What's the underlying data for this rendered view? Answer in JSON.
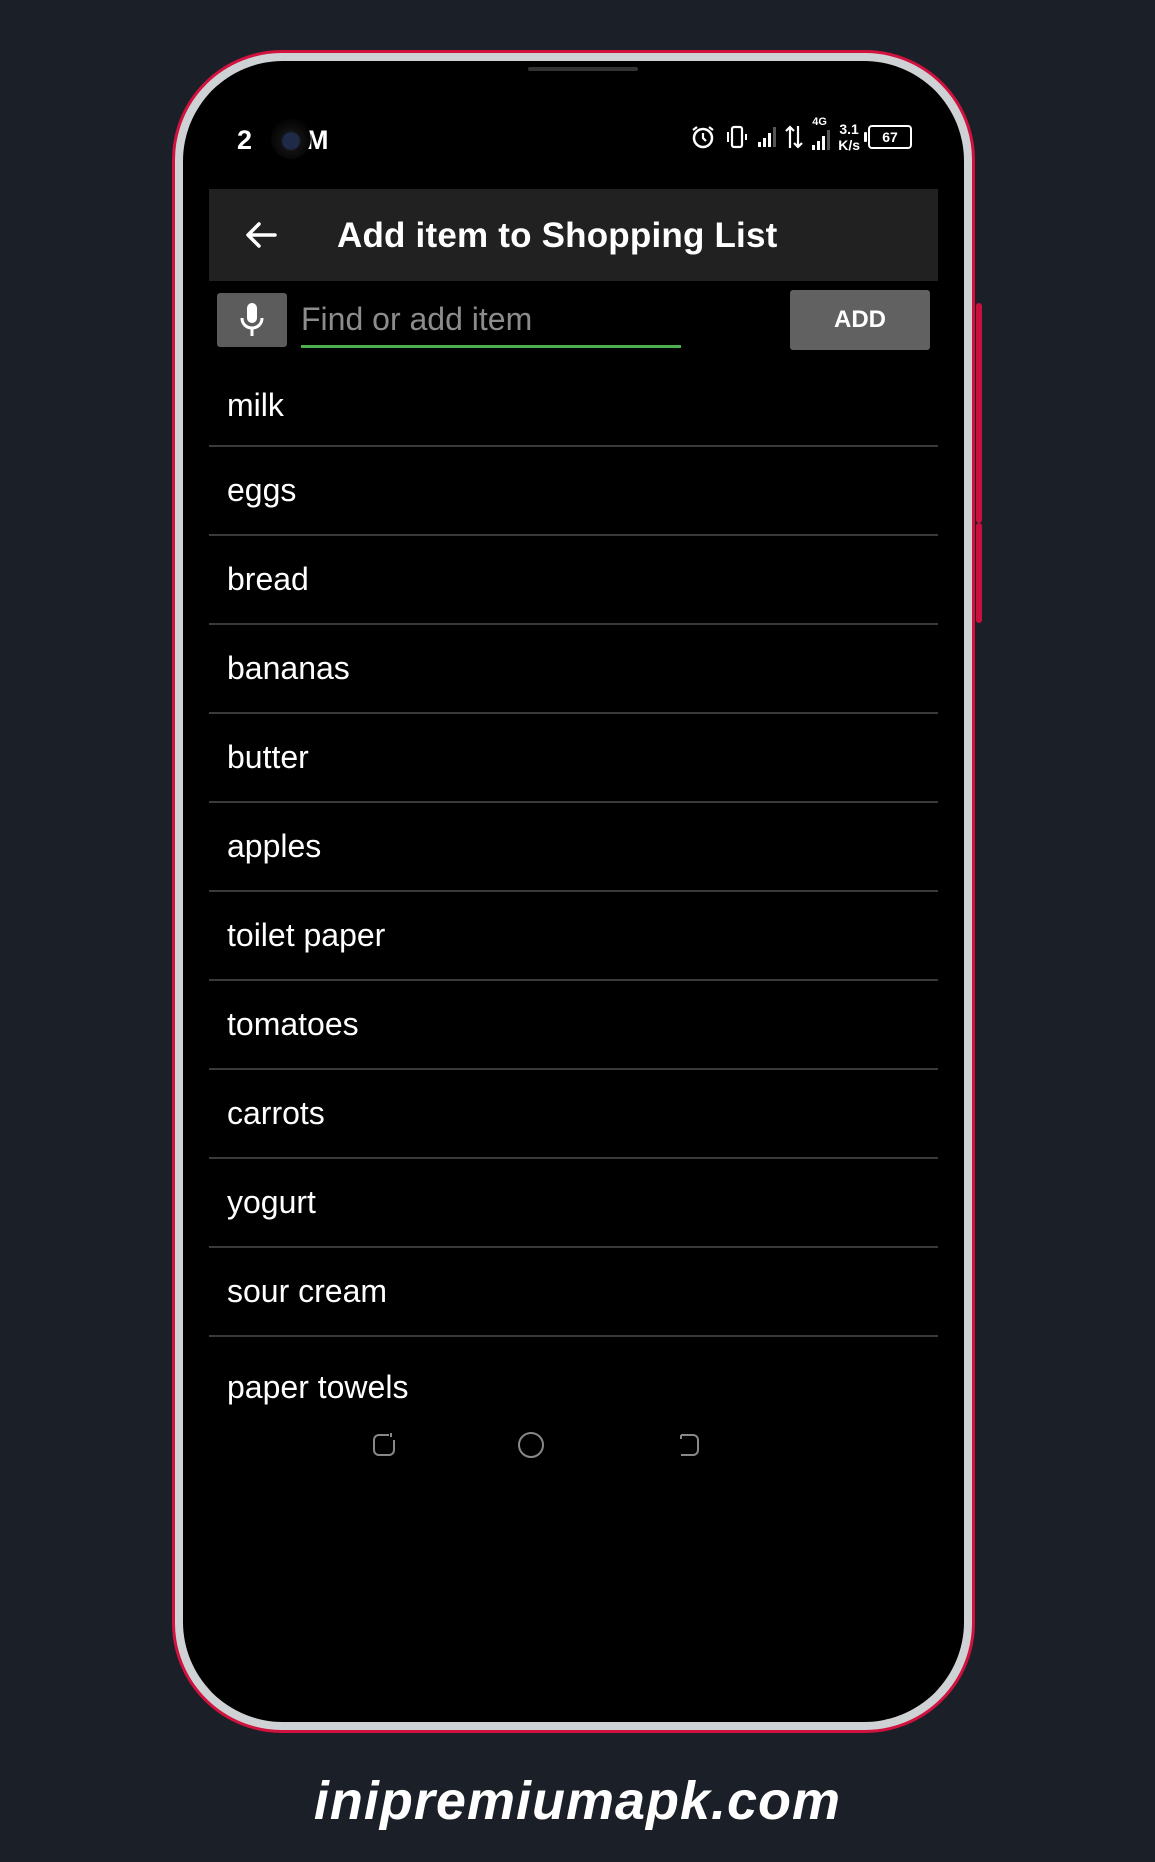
{
  "status_bar": {
    "time": "2",
    "ampm": "PM",
    "network_type": "4G",
    "speed_value": "3.1",
    "speed_unit": "K/s",
    "battery": "67",
    "icons": [
      "alarm-icon",
      "vibrate-icon",
      "signal-icon",
      "data-transfer-icon",
      "signal-4g-icon",
      "battery-icon"
    ]
  },
  "app_bar": {
    "title": "Add item to Shopping List",
    "back_icon": "arrow-left-icon"
  },
  "search": {
    "placeholder": "Find or add item",
    "value": "",
    "mic_icon": "microphone-icon",
    "add_label": "ADD",
    "accent_color": "#4caf50"
  },
  "items": [
    {
      "label": "milk"
    },
    {
      "label": "eggs"
    },
    {
      "label": "bread"
    },
    {
      "label": "bananas"
    },
    {
      "label": "butter"
    },
    {
      "label": "apples"
    },
    {
      "label": "toilet paper"
    },
    {
      "label": "tomatoes"
    },
    {
      "label": "carrots"
    },
    {
      "label": "yogurt"
    },
    {
      "label": "sour cream"
    },
    {
      "label": "paper towels"
    }
  ],
  "nav_bar": {
    "buttons": [
      "recent-apps",
      "home",
      "back"
    ]
  },
  "watermark": "inipremiumapk.com"
}
